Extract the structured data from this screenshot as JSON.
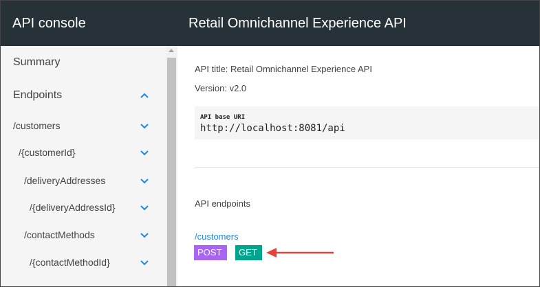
{
  "app": {
    "title": "API console"
  },
  "header": {
    "title": "Retail Omnichannel Experience API"
  },
  "sidebar": {
    "items": [
      {
        "label": "Summary",
        "chevron": null
      },
      {
        "label": "Endpoints",
        "chevron": "up"
      },
      {
        "label": "/customers",
        "chevron": "down"
      },
      {
        "label": "/{customerId}",
        "chevron": "down"
      },
      {
        "label": "/deliveryAddresses",
        "chevron": "down"
      },
      {
        "label": "/{deliveryAddressId}",
        "chevron": "down"
      },
      {
        "label": "/contactMethods",
        "chevron": "down"
      },
      {
        "label": "/{contactMethodId}",
        "chevron": "down"
      }
    ]
  },
  "main": {
    "api_title_line": "API title: Retail Omnichannel Experience API",
    "version_line": "Version: v2.0",
    "base_uri_label": "API base URI",
    "base_uri_value": "http://localhost:8081/api",
    "endpoints_heading": "API endpoints",
    "endpoint": {
      "path": "/customers",
      "methods": [
        "POST",
        "GET"
      ]
    }
  },
  "colors": {
    "topbar": "#263238",
    "sidebar_bg": "#f5f5f5",
    "accent": "#1e88e5",
    "chevron": "#1e88e5",
    "post": "#a765f1",
    "get": "#00a58c",
    "annotation_arrow": "#e8413a"
  },
  "icons": {
    "chevron_up": "chevron-up-icon",
    "chevron_down": "chevron-down-icon",
    "annotation": "arrow-left-annotation"
  }
}
